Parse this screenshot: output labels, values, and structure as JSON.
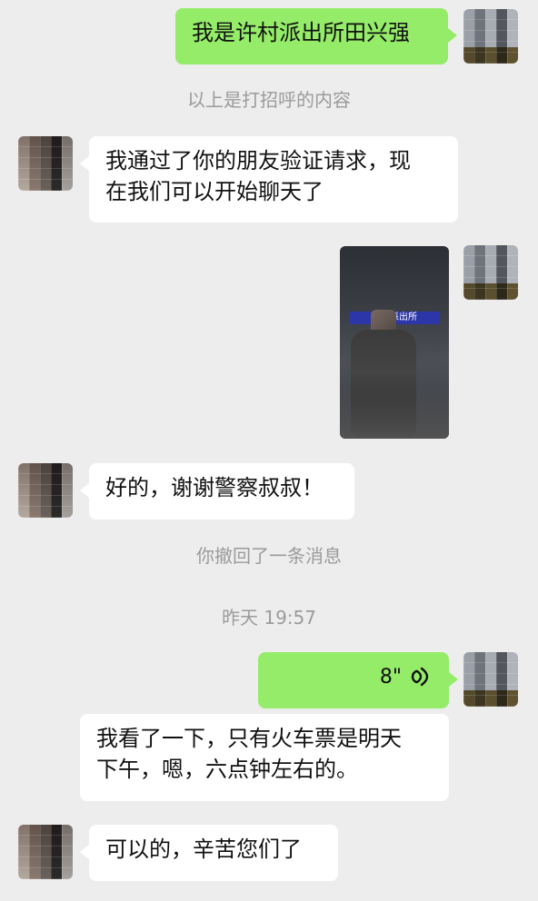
{
  "messages": [
    {
      "id": "m1",
      "side": "right",
      "type": "text",
      "text": "我是许村派出所田兴强"
    },
    {
      "id": "s1",
      "type": "system",
      "text": "以上是打招呼的内容"
    },
    {
      "id": "m2",
      "side": "left",
      "type": "text",
      "line1": "我通过了你的朋友验证请求，现",
      "line2": "在我们可以开始聊天了"
    },
    {
      "id": "m3",
      "side": "right",
      "type": "image",
      "image_text": "许村派出所"
    },
    {
      "id": "m4",
      "side": "left",
      "type": "text",
      "text": "好的，谢谢警察叔叔！"
    },
    {
      "id": "s2",
      "type": "system",
      "text": "你撤回了一条消息"
    },
    {
      "id": "s3",
      "type": "system",
      "text": "昨天 19:57"
    },
    {
      "id": "m5",
      "side": "right",
      "type": "voice",
      "duration": "8\""
    },
    {
      "id": "m6",
      "side": "left",
      "type": "text",
      "line1": "我看了一下，只有火车票是明天",
      "line2": "下午，嗯，六点钟左右的。"
    },
    {
      "id": "m7",
      "side": "left",
      "type": "text",
      "text": "可以的，辛苦您们了"
    }
  ],
  "colors": {
    "self_bubble": "#95ec69",
    "other_bubble": "#ffffff",
    "background": "#ededed",
    "system_text": "#9b9b9b"
  },
  "icons": {
    "voice": "voice-wave-icon"
  }
}
